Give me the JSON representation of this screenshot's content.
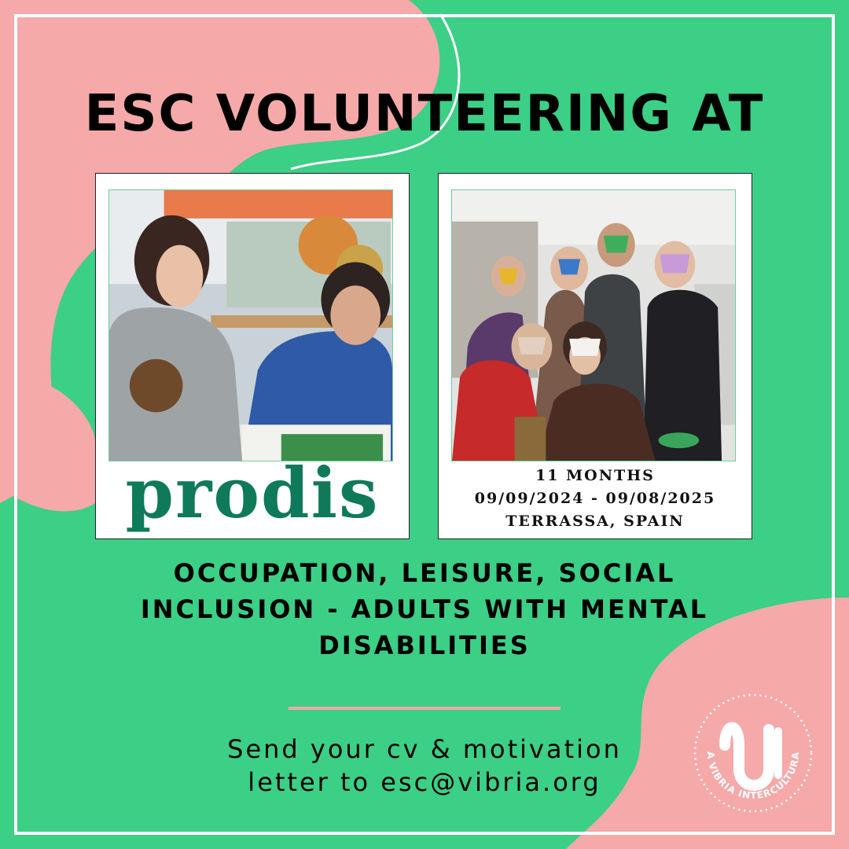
{
  "colors": {
    "background": "#3ccf86",
    "blob": "#f5a9a9",
    "frame": "#ffffff",
    "text": "#000000",
    "logo_green": "#0f7a5a"
  },
  "headline": "ESC VOLUNTEERING AT",
  "left_card": {
    "photo_icon": "photo-volunteers-reading",
    "logo_text": "prodis"
  },
  "right_card": {
    "photo_icon": "photo-group-masks",
    "duration": "11 MONTHS",
    "dates": "09/09/2024 - 09/08/2025",
    "location": "TERRASSA, SPAIN"
  },
  "subtitle": {
    "line1": "OCCUPATION, LEISURE, SOCIAL",
    "line2": "INCLUSION - ADULTS WITH MENTAL",
    "line3": "DISABILITIES"
  },
  "cta": {
    "line1": "Send your cv & motivation",
    "line2": "letter to esc@vibria.org"
  },
  "footer_logo": {
    "text": "LA VIBRIA INTERCULTURAL",
    "icon": "vibria-logo-icon"
  }
}
